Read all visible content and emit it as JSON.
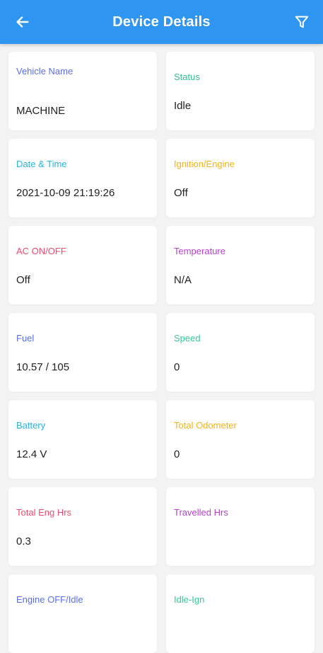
{
  "header": {
    "title": "Device Details",
    "back_icon": "arrow-left-icon",
    "filter_icon": "filter-icon",
    "color": "#2e95f0"
  },
  "cards": [
    {
      "label": "Vehicle Name",
      "value": "MACHINE",
      "color": "#5b6ee8"
    },
    {
      "label": "Status",
      "value": "Idle",
      "color": "#2cc08e"
    },
    {
      "label": "Date & Time",
      "value": "2021-10-09 21:19:26",
      "color": "#25b4de"
    },
    {
      "label": "Ignition/Engine",
      "value": "Off",
      "color": "#f2b21a"
    },
    {
      "label": "AC ON/OFF",
      "value": "Off",
      "color": "#ef4a6e"
    },
    {
      "label": "Temperature",
      "value": "N/A",
      "color": "#b93fd0"
    },
    {
      "label": "Fuel",
      "value": "10.57 / 105",
      "color": "#5b6ee8"
    },
    {
      "label": "Speed",
      "value": "0",
      "color": "#2cc08e"
    },
    {
      "label": "Battery",
      "value": "12.4 V",
      "color": "#25b4de"
    },
    {
      "label": "Total Odometer",
      "value": "0",
      "color": "#f2b21a"
    },
    {
      "label": "Total Eng Hrs",
      "value": "0.3",
      "color": "#ef4a6e"
    },
    {
      "label": "Travelled Hrs",
      "value": "",
      "color": "#b93fd0"
    },
    {
      "label": "Engine OFF/Idle",
      "value": "",
      "color": "#5b6ee8"
    },
    {
      "label": "Idle-Ign",
      "value": "",
      "color": "#2cc08e"
    }
  ]
}
